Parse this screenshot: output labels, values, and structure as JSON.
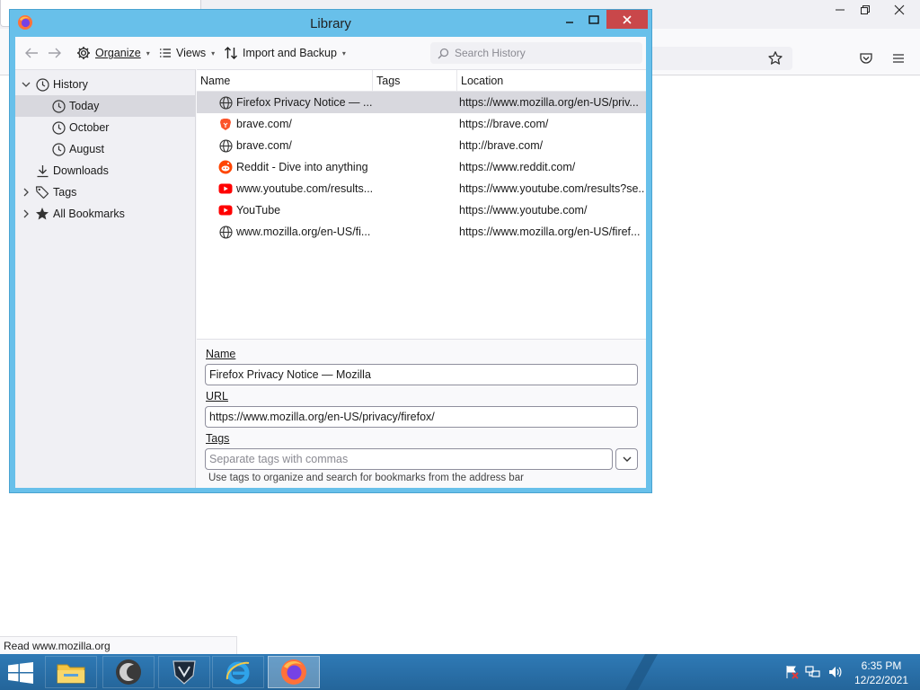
{
  "status_bar": {
    "text": "Read www.mozilla.org"
  },
  "library": {
    "title": "Library",
    "toolbar": {
      "organize": "Organize",
      "views": "Views",
      "import_backup": "Import and Backup",
      "search_placeholder": "Search History"
    },
    "tree": {
      "history": "History",
      "today": "Today",
      "october": "October",
      "august": "August",
      "downloads": "Downloads",
      "tags": "Tags",
      "all_bookmarks": "All Bookmarks"
    },
    "columns": {
      "name": "Name",
      "tags": "Tags",
      "location": "Location"
    },
    "rows": [
      {
        "name": "Firefox Privacy Notice — ...",
        "location": "https://www.mozilla.org/en-US/priv...",
        "icon": "globe-icon"
      },
      {
        "name": "brave.com/",
        "location": "https://brave.com/",
        "icon": "brave-icon"
      },
      {
        "name": "brave.com/",
        "location": "http://brave.com/",
        "icon": "globe-icon"
      },
      {
        "name": "Reddit - Dive into anything",
        "location": "https://www.reddit.com/",
        "icon": "reddit-icon"
      },
      {
        "name": "www.youtube.com/results...",
        "location": "https://www.youtube.com/results?se...",
        "icon": "youtube-icon"
      },
      {
        "name": "YouTube",
        "location": "https://www.youtube.com/",
        "icon": "youtube-icon"
      },
      {
        "name": "www.mozilla.org/en-US/fi...",
        "location": "https://www.mozilla.org/en-US/firef...",
        "icon": "globe-icon"
      }
    ],
    "details": {
      "name_label": "Name",
      "name_value": "Firefox Privacy Notice — Mozilla",
      "url_label": "URL",
      "url_value": "https://www.mozilla.org/en-US/privacy/firefox/",
      "tags_label": "Tags",
      "tags_placeholder": "Separate tags with commas",
      "hint": "Use tags to organize and search for bookmarks from the address bar"
    }
  },
  "taskbar": {
    "time": "6:35 PM",
    "date": "12/22/2021"
  },
  "colors": {
    "window_frame": "#68c0ea",
    "close_button": "#c9474a",
    "selection": "#d8d8de",
    "taskbar": "#2a6fa5"
  }
}
